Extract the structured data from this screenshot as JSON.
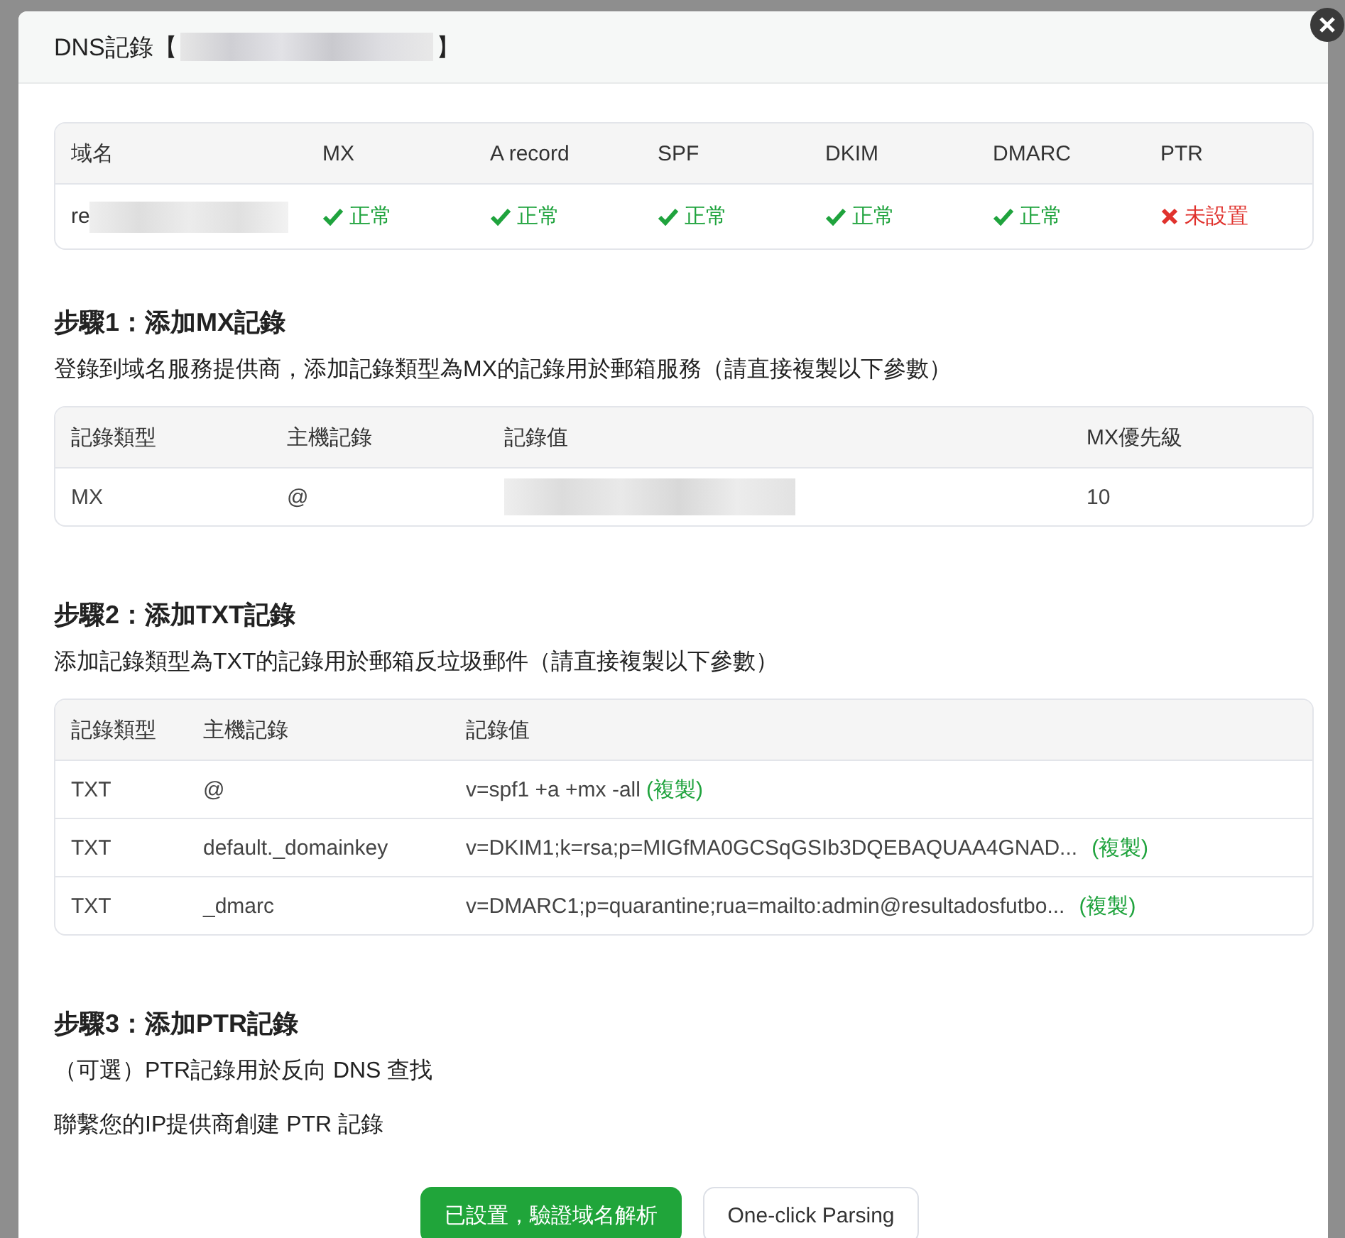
{
  "dialog": {
    "title_prefix": "DNS記錄【",
    "title_suffix": "】",
    "status_table": {
      "columns": [
        "域名",
        "MX",
        "A record",
        "SPF",
        "DKIM",
        "DMARC",
        "PTR"
      ],
      "rows": [
        {
          "cells": [
            {
              "kind": "domain",
              "text": "re"
            },
            {
              "kind": "ok",
              "text": "正常"
            },
            {
              "kind": "ok",
              "text": "正常"
            },
            {
              "kind": "ok",
              "text": "正常"
            },
            {
              "kind": "ok",
              "text": "正常"
            },
            {
              "kind": "ok",
              "text": "正常"
            },
            {
              "kind": "missing",
              "text": "未設置"
            }
          ]
        }
      ]
    },
    "steps": [
      {
        "heading": "步驟1：添加MX記錄",
        "lines": [
          "登錄到域名服務提供商，添加記錄類型為MX的記錄用於郵箱服務（請直接複製以下參數）"
        ],
        "table": {
          "columns": [
            "記錄類型",
            "主機記錄",
            "記錄值",
            "MX優先級"
          ],
          "rows": [
            {
              "cells": [
                {
                  "kind": "text",
                  "text": "MX"
                },
                {
                  "kind": "text",
                  "text": "@"
                },
                {
                  "kind": "redacted"
                },
                {
                  "kind": "text",
                  "text": "10"
                }
              ]
            }
          ]
        }
      },
      {
        "heading": "步驟2：添加TXT記錄",
        "lines": [
          "添加記錄類型為TXT的記錄用於郵箱反垃圾郵件（請直接複製以下參數）"
        ],
        "table": {
          "columns": [
            "記錄類型",
            "主機記錄",
            "記錄值"
          ],
          "rows": [
            {
              "cells": [
                {
                  "kind": "text",
                  "text": "TXT"
                },
                {
                  "kind": "text",
                  "text": "@"
                },
                {
                  "kind": "value",
                  "text": "v=spf1 +a +mx -all",
                  "copy": "(複製)"
                }
              ]
            },
            {
              "cells": [
                {
                  "kind": "text",
                  "text": "TXT"
                },
                {
                  "kind": "text",
                  "text": "default._domainkey"
                },
                {
                  "kind": "value",
                  "text": "v=DKIM1;k=rsa;p=MIGfMA0GCSqGSIb3DQEBAQUAA4GNAD...",
                  "copy": "(複製)"
                }
              ]
            },
            {
              "cells": [
                {
                  "kind": "text",
                  "text": "TXT"
                },
                {
                  "kind": "text",
                  "text": "_dmarc"
                },
                {
                  "kind": "value",
                  "text": "v=DMARC1;p=quarantine;rua=mailto:admin@resultadosfutbo...",
                  "copy": "(複製)"
                }
              ]
            }
          ]
        }
      },
      {
        "heading": "步驟3：添加PTR記錄",
        "lines": [
          "（可選）PTR記錄用於反向 DNS 查找",
          "聯繫您的IP提供商創建 PTR 記錄"
        ]
      }
    ],
    "buttons": [
      {
        "kind": "primary",
        "label": "已設置，驗證域名解析"
      },
      {
        "kind": "secondary",
        "label": "One-click Parsing"
      }
    ]
  }
}
